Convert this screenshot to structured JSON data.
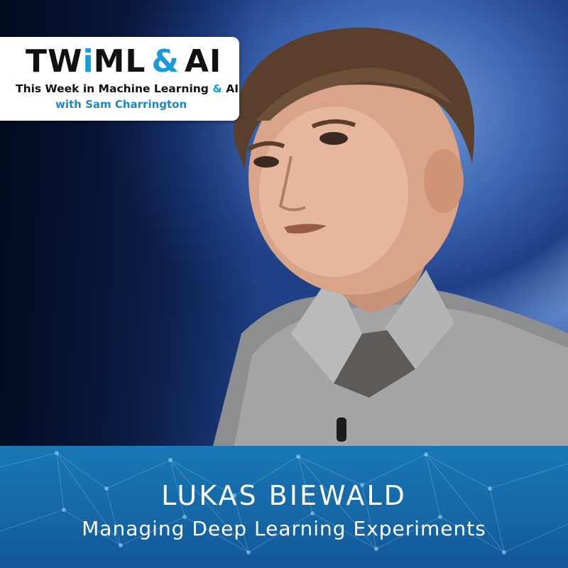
{
  "logo": {
    "brand_left": "TW",
    "brand_i": "i",
    "brand_right": "ML",
    "brand_amp": "&",
    "brand_ai": "AI",
    "tagline_main": "This Week in Machine Learning",
    "tagline_amp": "&",
    "tagline_ai": "AI",
    "host": "with Sam Charrington",
    "accent_color": "#1a9bd6"
  },
  "episode": {
    "guest_name": "LUKAS BIEWALD",
    "title": "Managing Deep Learning Experiments"
  },
  "photo": {
    "subject": "speaker-portrait"
  },
  "colors": {
    "banner": "#1667a6",
    "background": "#22468f"
  }
}
